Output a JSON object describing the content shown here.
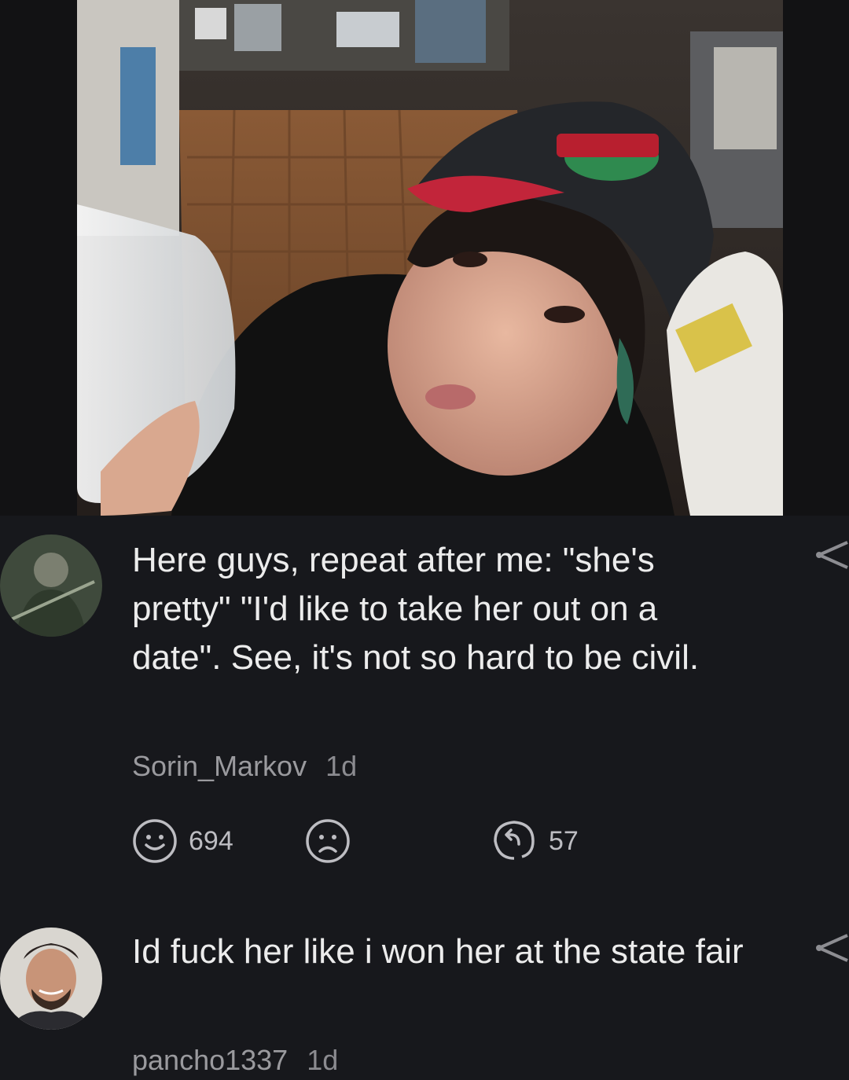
{
  "post": {
    "image_icon": "photo"
  },
  "comments": [
    {
      "avatar_icon": "user-avatar",
      "text": "Here guys, repeat after me: \"she's pretty\" \"I'd like to take her out on a date\". See, it's not so hard to be civil.",
      "author": "Sorin_Markov",
      "time": "1d",
      "likes": "694",
      "replies": "57",
      "share_icon": "share-icon"
    },
    {
      "avatar_icon": "user-avatar",
      "text": "Id fuck her like i won her at the state fair",
      "author": "pancho1337",
      "time": "1d",
      "share_icon": "share-icon"
    }
  ],
  "colors": {
    "background": "#17181c",
    "text": "#ececec",
    "meta": "#9a9a9e"
  }
}
